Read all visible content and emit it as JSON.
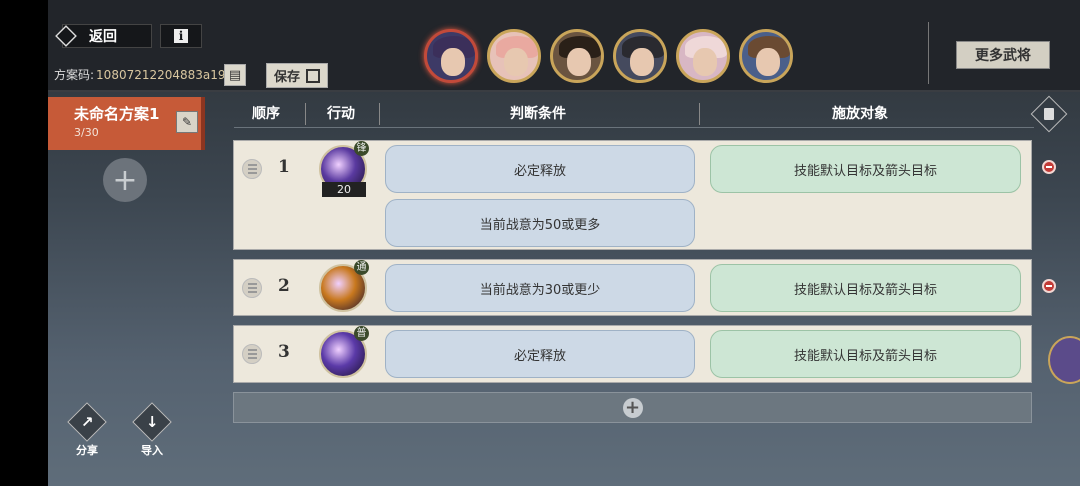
{
  "topbar": {
    "back_label": "返回",
    "info_label": "i",
    "code_label": "方案码:",
    "code_value": "10807212204883a19",
    "save_label": "保存",
    "more_label": "更多武将"
  },
  "portraits": [
    {
      "name": "portrait-1",
      "hair": "#3b2f5a",
      "bg": "#3d3a66",
      "selected": true
    },
    {
      "name": "portrait-2",
      "hair": "#e9a9a0",
      "bg": "#e7c2b8",
      "selected": false
    },
    {
      "name": "portrait-3",
      "hair": "#2a2018",
      "bg": "#6a5440",
      "selected": false
    },
    {
      "name": "portrait-4",
      "hair": "#2a2a30",
      "bg": "#454a5e",
      "selected": false
    },
    {
      "name": "portrait-5",
      "hair": "#efd8d8",
      "bg": "#d8b7c4",
      "selected": false
    },
    {
      "name": "portrait-6",
      "hair": "#6a4a32",
      "bg": "#4a5f8a",
      "selected": false
    }
  ],
  "plan": {
    "name": "未命名方案1",
    "count": "3/30"
  },
  "headers": {
    "order": "顺序",
    "action": "行动",
    "condition": "判断条件",
    "target": "施放对象"
  },
  "rows": [
    {
      "num": "1",
      "skill_color": "#5a3aa0",
      "badge": "锋",
      "cost": "20",
      "conditions": [
        "必定释放",
        "当前战意为50或更多"
      ],
      "target": "技能默认目标及箭头目标"
    },
    {
      "num": "2",
      "skill_color": "#c8781e",
      "badge": "通",
      "conditions": [
        "当前战意为30或更少"
      ],
      "target": "技能默认目标及箭头目标"
    },
    {
      "num": "3",
      "skill_color": "#5b3aa8",
      "badge": "普",
      "conditions": [
        "必定释放"
      ],
      "target": "技能默认目标及箭头目标"
    }
  ],
  "side": {
    "share_label": "分享",
    "import_label": "导入"
  }
}
